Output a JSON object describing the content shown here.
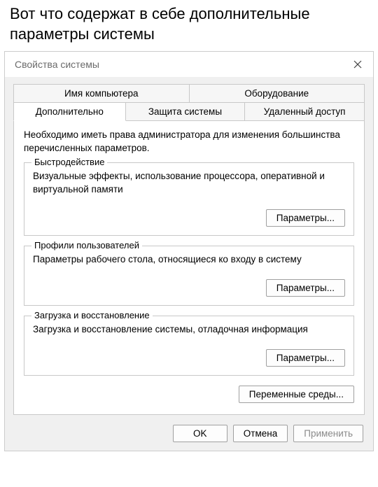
{
  "page_heading": "Вот что содержат в себе дополнительные параметры системы",
  "window": {
    "title": "Свойства системы",
    "tabs_row1": [
      {
        "label": "Имя компьютера"
      },
      {
        "label": "Оборудование"
      }
    ],
    "tabs_row2": [
      {
        "label": "Дополнительно",
        "active": true
      },
      {
        "label": "Защита системы"
      },
      {
        "label": "Удаленный доступ"
      }
    ],
    "intro": "Необходимо иметь права администратора для изменения большинства перечисленных параметров.",
    "groups": {
      "performance": {
        "legend": "Быстродействие",
        "desc": "Визуальные эффекты, использование процессора, оперативной и виртуальной памяти",
        "button": "Параметры..."
      },
      "profiles": {
        "legend": "Профили пользователей",
        "desc": "Параметры рабочего стола, относящиеся ко входу в систему",
        "button": "Параметры..."
      },
      "startup": {
        "legend": "Загрузка и восстановление",
        "desc": "Загрузка и восстановление системы, отладочная информация",
        "button": "Параметры..."
      }
    },
    "env_vars_button": "Переменные среды...",
    "buttons": {
      "ok": "OK",
      "cancel": "Отмена",
      "apply": "Применить"
    }
  }
}
